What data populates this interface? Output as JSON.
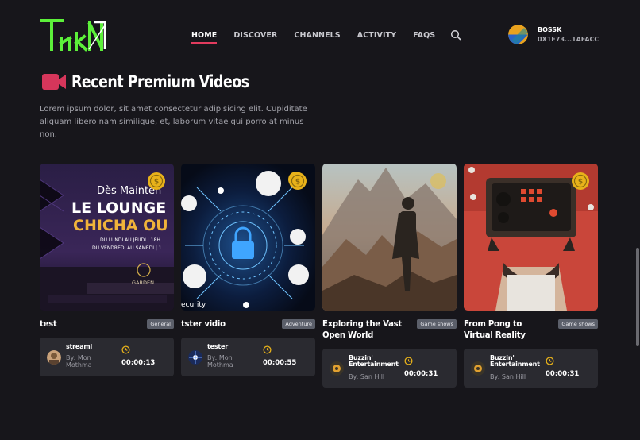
{
  "nav": {
    "items": [
      {
        "label": "HOME",
        "active": true
      },
      {
        "label": "DISCOVER",
        "active": false
      },
      {
        "label": "CHANNELS",
        "active": false
      },
      {
        "label": "ACTIVITY",
        "active": false
      },
      {
        "label": "FAQS",
        "active": false
      }
    ],
    "search_icon": "search-icon"
  },
  "user": {
    "name": "BOSSK",
    "address": "0X1F73...1AFACC"
  },
  "section": {
    "title": "Recent Premium Videos",
    "icon": "video-camera-icon",
    "description": "Lorem ipsum dolor, sit amet consectetur adipisicing elit. Cupiditate aliquam libero nam similique, et, laborum vitae qui porro at minus non."
  },
  "colors": {
    "accent": "#e23b5e",
    "logo_green": "#5cf03a",
    "coin_gold": "#e8b21a",
    "background": "#17161b",
    "card_panel": "#2a2a30"
  },
  "cards": [
    {
      "title": "test",
      "category": "General",
      "channel": "streami",
      "by": "By: Mon Mothma",
      "duration": "00:00:13",
      "thumb_lines": [
        "Dès Mainten",
        "LE LOUNGE",
        "CHICHA OU",
        "DU LUNDI AU JEUDI | 18H",
        "DU VENDREDI AU SAMEDI | 1",
        "GARDEN"
      ]
    },
    {
      "title": "tster vidio",
      "category": "Adventure",
      "channel": "tester",
      "by": "By: Mon Mothma",
      "duration": "00:00:55",
      "thumb_lines": [
        "ecurity"
      ]
    },
    {
      "title": "Exploring the Vast Open World",
      "category": "Game shows",
      "channel": "Buzzin' Entertainment",
      "by": "By: San Hill",
      "duration": "00:00:31"
    },
    {
      "title": "From Pong to Virtual Reality",
      "category": "Game shows",
      "channel": "Buzzin' Entertainment",
      "by": "By: San Hill",
      "duration": "00:00:31"
    }
  ]
}
